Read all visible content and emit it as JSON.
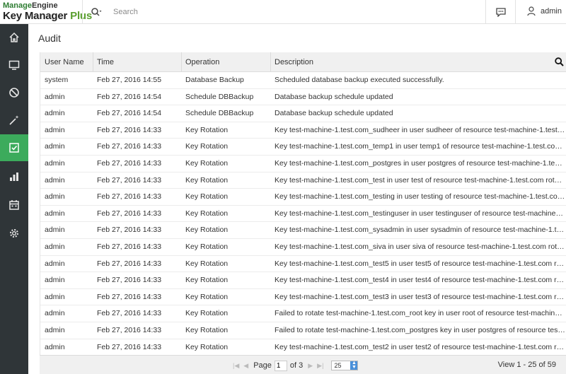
{
  "app": {
    "logo_line1_a": "Manage",
    "logo_line1_b": "Engine",
    "logo_line2_a": "Key Manager ",
    "logo_line2_b": "Plus"
  },
  "header": {
    "search_placeholder": "Search",
    "user_name": "admin"
  },
  "sidebar": {
    "items": [
      {
        "icon": "home-icon",
        "active": false
      },
      {
        "icon": "monitor-icon",
        "active": false
      },
      {
        "icon": "blocked-icon",
        "active": false
      },
      {
        "icon": "magic-wand-icon",
        "active": false
      },
      {
        "icon": "audit-check-icon",
        "active": true
      },
      {
        "icon": "bar-chart-icon",
        "active": false
      },
      {
        "icon": "calendar-icon",
        "active": false
      },
      {
        "icon": "settings-gear-icon",
        "active": false
      }
    ]
  },
  "page": {
    "title": "Audit"
  },
  "table": {
    "columns": [
      "User Name",
      "Time",
      "Operation",
      "Description"
    ],
    "rows": [
      [
        "system",
        "Feb 27, 2016 14:55",
        "Database Backup",
        "Scheduled database backup executed successfully."
      ],
      [
        "admin",
        "Feb 27, 2016 14:54",
        "Schedule DBBackup",
        "Database backup schedule updated"
      ],
      [
        "admin",
        "Feb 27, 2016 14:54",
        "Schedule DBBackup",
        "Database backup schedule updated"
      ],
      [
        "admin",
        "Feb 27, 2016 14:33",
        "Key Rotation",
        "Key test-machine-1.test.com_sudheer in user sudheer of resource test-machine-1.test.com"
      ],
      [
        "admin",
        "Feb 27, 2016 14:33",
        "Key Rotation",
        "Key test-machine-1.test.com_temp1 in user temp1 of resource test-machine-1.test.com rotat..."
      ],
      [
        "admin",
        "Feb 27, 2016 14:33",
        "Key Rotation",
        "Key test-machine-1.test.com_postgres in user postgres of resource test-machine-1.test.co..."
      ],
      [
        "admin",
        "Feb 27, 2016 14:33",
        "Key Rotation",
        "Key test-machine-1.test.com_test in user test of resource test-machine-1.test.com rotated ..."
      ],
      [
        "admin",
        "Feb 27, 2016 14:33",
        "Key Rotation",
        "Key test-machine-1.test.com_testing in user testing of resource test-machine-1.test.com ro..."
      ],
      [
        "admin",
        "Feb 27, 2016 14:33",
        "Key Rotation",
        "Key test-machine-1.test.com_testinguser in user testinguser of resource test-machine-1.te..."
      ],
      [
        "admin",
        "Feb 27, 2016 14:33",
        "Key Rotation",
        "Key test-machine-1.test.com_sysadmin in user sysadmin of resource test-machine-1.test.co..."
      ],
      [
        "admin",
        "Feb 27, 2016 14:33",
        "Key Rotation",
        "Key test-machine-1.test.com_siva in user siva of resource test-machine-1.test.com rotated ..."
      ],
      [
        "admin",
        "Feb 27, 2016 14:33",
        "Key Rotation",
        "Key test-machine-1.test.com_test5 in user test5 of resource test-machine-1.test.com rotat..."
      ],
      [
        "admin",
        "Feb 27, 2016 14:33",
        "Key Rotation",
        "Key test-machine-1.test.com_test4 in user test4 of resource test-machine-1.test.com rotat..."
      ],
      [
        "admin",
        "Feb 27, 2016 14:33",
        "Key Rotation",
        "Key test-machine-1.test.com_test3 in user test3 of resource test-machine-1.test.com rotat..."
      ],
      [
        "admin",
        "Feb 27, 2016 14:33",
        "Key Rotation",
        "Failed to rotate test-machine-1.test.com_root key in user root of resource test-machine-1..."
      ],
      [
        "admin",
        "Feb 27, 2016 14:33",
        "Key Rotation",
        "Failed to rotate test-machine-1.test.com_postgres key in user postgres of resource test-m..."
      ],
      [
        "admin",
        "Feb 27, 2016 14:33",
        "Key Rotation",
        "Key test-machine-1.test.com_test2 in user test2 of resource test-machine-1.test.com rotat..."
      ]
    ]
  },
  "pagination": {
    "page_label": "Page",
    "current_page": "1",
    "of_label": "of 3",
    "page_size": "25",
    "view_info": "View 1 - 25 of 59"
  },
  "colors": {
    "sidebar_bg": "#2f3538",
    "sidebar_active": "#3cab5c",
    "brand_green": "#5a9e2f"
  }
}
